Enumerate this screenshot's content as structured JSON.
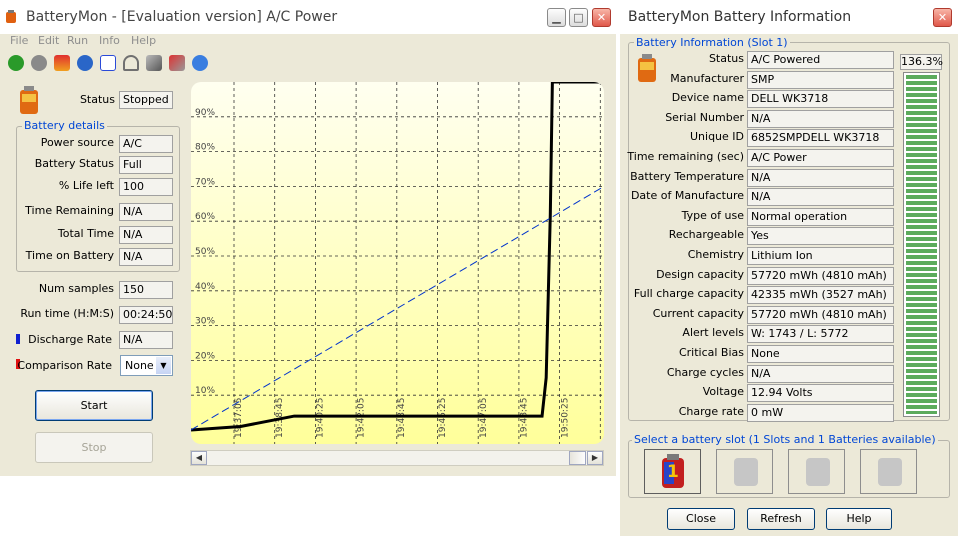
{
  "main_window": {
    "title": "BatteryMon - [Evaluation version] A/C Power",
    "menu": [
      "File",
      "Edit",
      "Run",
      "Info",
      "Help"
    ],
    "toolbar_icons": [
      "start-icon",
      "stop-icon",
      "battery-icon",
      "info-icon",
      "checklist-icon",
      "gauge-icon",
      "satellite-icon",
      "tools-icon",
      "help-icon"
    ],
    "status_label": "Status",
    "status_value": "Stopped",
    "battery_details": {
      "title": "Battery details",
      "rows": [
        {
          "label": "Power source",
          "value": "A/C"
        },
        {
          "label": "Battery Status",
          "value": "Full"
        },
        {
          "label": "% Life left",
          "value": "100"
        },
        {
          "label": "Time Remaining",
          "value": "N/A"
        },
        {
          "label": "Total Time",
          "value": "N/A"
        },
        {
          "label": "Time on Battery",
          "value": "N/A"
        }
      ]
    },
    "num_samples": {
      "label": "Num samples",
      "value": "150"
    },
    "run_time": {
      "label": "Run time (H:M:S)",
      "value": "00:24:50"
    },
    "discharge_rate": {
      "label": "Discharge Rate",
      "value": "N/A"
    },
    "comparison_rate": {
      "label": "Comparison Rate",
      "value": "None"
    },
    "start_label": "Start",
    "stop_label": "Stop"
  },
  "chart_data": {
    "type": "line",
    "title": "",
    "xlabel": "",
    "ylabel": "",
    "x_ticks": [
      "19:37:05",
      "19:38:45",
      "19:40:25",
      "19:42:05",
      "19:43:45",
      "19:45:25",
      "19:47:05",
      "19:48:45",
      "19:50:25"
    ],
    "y_ticks": [
      "10%",
      "20%",
      "30%",
      "40%",
      "50%",
      "60%",
      "70%",
      "80%",
      "90%"
    ],
    "ylim": [
      0,
      100
    ],
    "grid": true,
    "series": [
      {
        "color": "#000000",
        "style": "solid",
        "points": [
          [
            0,
            0
          ],
          [
            0.12,
            1
          ],
          [
            0.25,
            4
          ],
          [
            0.4,
            4
          ],
          [
            0.58,
            4
          ],
          [
            0.75,
            4
          ],
          [
            0.85,
            4
          ],
          [
            0.86,
            15
          ],
          [
            0.87,
            62
          ],
          [
            0.875,
            100
          ],
          [
            1.0,
            100
          ]
        ]
      },
      {
        "color": "#0033cc",
        "style": "dashed",
        "points": [
          [
            0,
            0
          ],
          [
            1.0,
            70
          ]
        ]
      }
    ]
  },
  "info_window": {
    "title": "BatteryMon Battery Information",
    "group_title": "Battery Information (Slot 1)",
    "charge_percent": "136.3%",
    "rows": [
      {
        "label": "Status",
        "value": "A/C Powered"
      },
      {
        "label": "Manufacturer",
        "value": "SMP"
      },
      {
        "label": "Device name",
        "value": "DELL WK3718"
      },
      {
        "label": "Serial Number",
        "value": "N/A"
      },
      {
        "label": "Unique ID",
        "value": "6852SMPDELL WK3718"
      },
      {
        "label": "Time remaining (sec)",
        "value": "A/C Power"
      },
      {
        "label": "Battery Temperature",
        "value": "N/A"
      },
      {
        "label": "Date of Manufacture",
        "value": "N/A"
      },
      {
        "label": "Type of use",
        "value": "Normal operation"
      },
      {
        "label": "Rechargeable",
        "value": "Yes"
      },
      {
        "label": "Chemistry",
        "value": "Lithium Ion"
      },
      {
        "label": "Design capacity",
        "value": "57720 mWh (4810 mAh)"
      },
      {
        "label": "Full charge capacity",
        "value": "42335 mWh (3527 mAh)"
      },
      {
        "label": "Current capacity",
        "value": "57720 mWh (4810 mAh)"
      },
      {
        "label": "Alert levels",
        "value": "W: 1743 / L: 5772"
      },
      {
        "label": "Critical Bias",
        "value": "None"
      },
      {
        "label": "Charge cycles",
        "value": "N/A"
      },
      {
        "label": "Voltage",
        "value": "12.94 Volts"
      },
      {
        "label": "Charge rate",
        "value": "0 mW"
      }
    ],
    "slot_group_title": "Select a battery slot (1 Slots and 1 Batteries available)",
    "slot1_label": "1",
    "close_label": "Close",
    "refresh_label": "Refresh",
    "help_label": "Help",
    "colors": {
      "accent_blue": "#0046d5",
      "level_green": "#5cab5c"
    }
  }
}
